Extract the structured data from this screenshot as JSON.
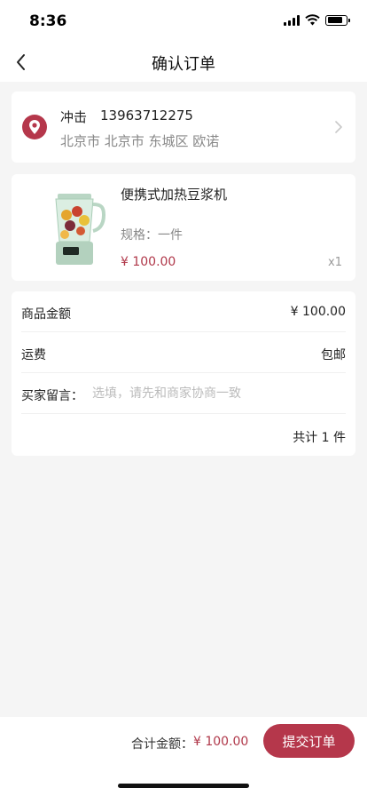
{
  "status_bar": {
    "time": "8:36"
  },
  "nav": {
    "title": "确认订单"
  },
  "address": {
    "name": "冲击",
    "phone": "13963712275",
    "detail": "北京市 北京市 东城区 欧诺"
  },
  "product": {
    "name": "便携式加热豆浆机",
    "spec": "规格：一件",
    "price": "¥ 100.00",
    "quantity": "x1"
  },
  "summary": {
    "amount_label": "商品金额",
    "amount_value": "¥ 100.00",
    "shipping_label": "运费",
    "shipping_value": "包邮",
    "note_label": "买家留言：",
    "note_placeholder": "选填，请先和商家协商一致",
    "total_count": "共计 1 件"
  },
  "footer": {
    "total_label": "合计金额：",
    "total_value": "¥ 100.00",
    "submit_label": "提交订单"
  },
  "colors": {
    "accent": "#b5374b",
    "background": "#f5f5f5"
  }
}
